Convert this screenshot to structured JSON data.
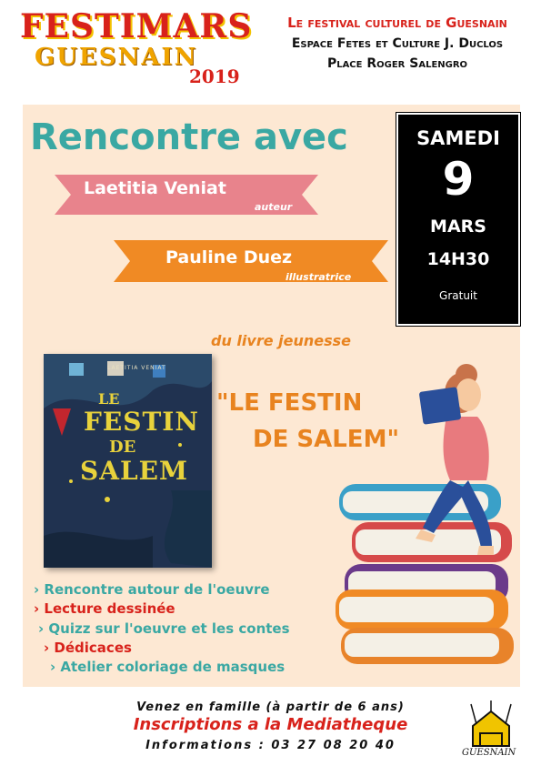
{
  "header": {
    "logo_main": "FESTIMARS",
    "logo_sub": "GUESNAIN",
    "logo_year": "2019",
    "line1": "Le festival culturel de Guesnain",
    "line2": "Espace Fetes et Culture J. Duclos",
    "line3": "Place Roger Salengro"
  },
  "event": {
    "title": "Rencontre avec",
    "author_name": "Laetitia Veniat",
    "author_role": "auteur",
    "illustrator_name": "Pauline Duez",
    "illustrator_role": "illustratrice",
    "book_intro": "du livre jeunesse",
    "book_title_line1": "\"LE FESTIN",
    "book_title_line2": "DE SALEM\""
  },
  "date": {
    "day": "SAMEDI",
    "number": "9",
    "month": "MARS",
    "time": "14H30",
    "price": "Gratuit"
  },
  "cover": {
    "author": "LAETITIA VENIAT",
    "title_line1": "LE",
    "title_line2": "FESTIN",
    "title_line3": "DE",
    "title_line4": "SALEM"
  },
  "activities": [
    "Rencontre autour de l'oeuvre",
    "Lecture dessinée",
    "Quizz sur l'oeuvre et les contes",
    "Dédicaces",
    "Atelier coloriage de masques"
  ],
  "footer": {
    "line1": "Venez en famille (à partir de 6 ans)",
    "line2": "Inscriptions a la Mediatheque",
    "line3": "Informations : 03 27 08 20 40",
    "logo_text": "GUESNAIN"
  },
  "colors": {
    "teal": "#3aa8a3",
    "pink": "#e8838c",
    "orange": "#f08a24",
    "red": "#d8221b",
    "panel": "#fde8d3",
    "bullet_teal": "#3aa8a3",
    "bullet_red": "#d8221b"
  }
}
